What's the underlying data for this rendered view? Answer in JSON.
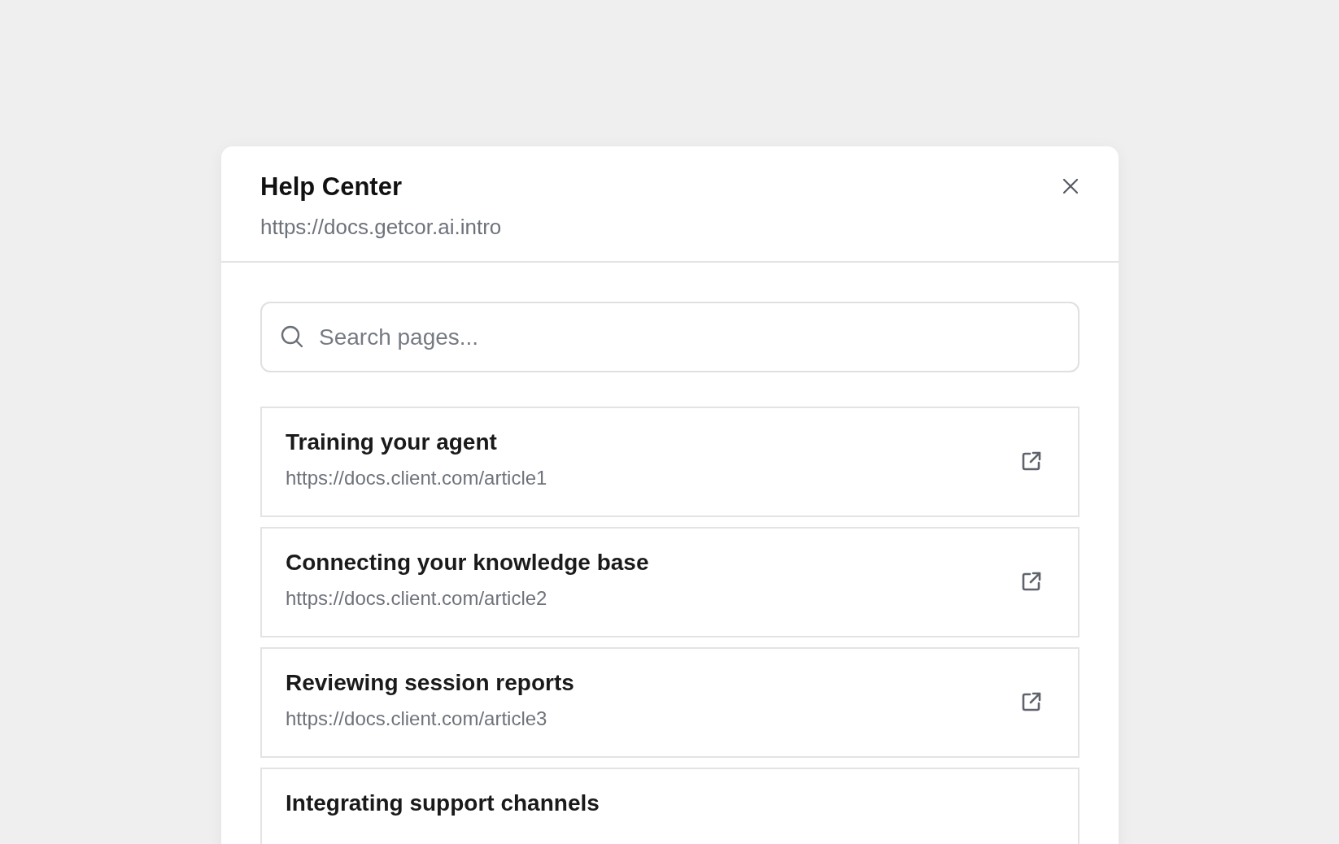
{
  "dialog": {
    "title": "Help Center",
    "subtitle": "https://docs.getcor.ai.intro"
  },
  "search": {
    "placeholder": "Search pages..."
  },
  "articles": [
    {
      "title": "Training your agent",
      "url": "https://docs.client.com/article1"
    },
    {
      "title": "Connecting your knowledge base",
      "url": "https://docs.client.com/article2"
    },
    {
      "title": "Reviewing session reports",
      "url": "https://docs.client.com/article3"
    },
    {
      "title": "Integrating support channels"
    }
  ]
}
